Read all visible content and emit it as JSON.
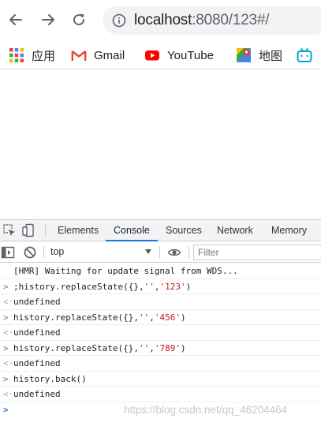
{
  "browser": {
    "back_icon": "arrow-left-icon",
    "forward_icon": "arrow-right-icon",
    "reload_icon": "reload-icon",
    "info_icon": "info-icon",
    "url_host": "localhost",
    "url_rest": ":8080/123#/"
  },
  "bookmarks": [
    {
      "label": "应用",
      "icon": "apps-grid-icon"
    },
    {
      "label": "Gmail",
      "icon": "gmail-icon"
    },
    {
      "label": "YouTube",
      "icon": "youtube-icon"
    },
    {
      "label": "地图",
      "icon": "maps-icon"
    },
    {
      "label": "",
      "icon": "bilibili-icon"
    }
  ],
  "devtools": {
    "tabs": [
      "Elements",
      "Console",
      "Sources",
      "Network",
      "Memory"
    ],
    "active_tab": "Console",
    "context": "top",
    "filter_placeholder": "Filter",
    "accent_color": "#1a73e8"
  },
  "console": {
    "lines": [
      {
        "type": "log",
        "text": "[HMR] Waiting for update signal from WDS..."
      },
      {
        "type": "input",
        "prefix": ";history.replaceState({},",
        "s1": "''",
        "sep": ",",
        "s2": "'123'",
        "suffix": ")"
      },
      {
        "type": "output",
        "text": "undefined"
      },
      {
        "type": "input",
        "prefix": "history.replaceState({},",
        "s1": "''",
        "sep": ",",
        "s2": "'456'",
        "suffix": ")"
      },
      {
        "type": "output",
        "text": "undefined"
      },
      {
        "type": "input",
        "prefix": "history.replaceState({},",
        "s1": "''",
        "sep": ",",
        "s2": "'789'",
        "suffix": ")"
      },
      {
        "type": "output",
        "text": "undefined"
      },
      {
        "type": "input",
        "text": "history.back()"
      },
      {
        "type": "output",
        "text": "undefined"
      }
    ],
    "input_mark": ">",
    "output_mark": "<·"
  },
  "watermark": "https://blog.csdn.net/qq_46204464"
}
